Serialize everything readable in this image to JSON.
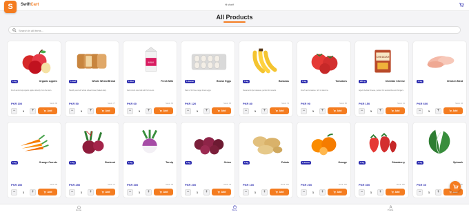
{
  "header": {
    "logo_letter": "S",
    "brand_main": "Swift",
    "brand_accent": "Cart",
    "greeting": "Hi sharif"
  },
  "page_title": "All Products",
  "search": {
    "placeholder": "Search in all items..."
  },
  "products": [
    {
      "name": "Organic Apples",
      "unit": "1 kg",
      "desc": "Fresh and crisp organic apples directly from the farm.",
      "price": "PKR 100",
      "stock": "Stock: 96",
      "qty": "1"
    },
    {
      "name": "Whole Wheat Bread",
      "unit": "1 loaf",
      "desc": "Healthy and soft whole wheat bread, baked daily.",
      "price": "PKR 50",
      "stock": "Stock: 77",
      "qty": "1"
    },
    {
      "name": "Fresh Milk",
      "unit": "1 liter",
      "desc": "Farm-fresh cow milk with full cream.",
      "price": "PKR 60",
      "stock": "Stock: 60",
      "qty": "1"
    },
    {
      "name": "Brown Eggs",
      "unit": "1 dozen",
      "desc": "Pack of 12 free-range brown eggs.",
      "price": "PKR 120",
      "stock": "Stock: 68",
      "qty": "1"
    },
    {
      "name": "Bananas",
      "unit": "1 kg",
      "desc": "Sweet and ripe bananas, perfect for snacks.",
      "price": "PKR 80",
      "stock": "Stock: 79",
      "qty": "1"
    },
    {
      "name": "Tomatoes",
      "unit": "1 kg",
      "desc": "Fresh red tomatoes, rich in vitamins.",
      "price": "PKR 90",
      "stock": "Stock: 86",
      "qty": "1"
    },
    {
      "name": "Cheddar Cheese",
      "unit": "200 g",
      "desc": "Aged cheddar cheese, perfect for sandwiches and burgers.",
      "price": "PKR 150",
      "stock": "Stock: 41",
      "qty": "1"
    },
    {
      "name": "Chicken Meat",
      "unit": "1 kg",
      "desc": "",
      "price": "PKR 600",
      "stock": "Stock: 34",
      "qty": "1"
    },
    {
      "name": "Orange Carrots",
      "unit": "1 kg",
      "desc": "",
      "price": "PKR 150",
      "stock": "Stock: 99",
      "qty": "1"
    },
    {
      "name": "Beetroot",
      "unit": "1 kg",
      "desc": "",
      "price": "PKR 250",
      "stock": "Stock: 37",
      "qty": "1"
    },
    {
      "name": "Turnip",
      "unit": "1 kg",
      "desc": "",
      "price": "PKR 300",
      "stock": "Stock: 99",
      "qty": "1"
    },
    {
      "name": "Onion",
      "unit": "1 kg",
      "desc": "",
      "price": "PKR 200",
      "stock": "Stock: 49",
      "qty": "1"
    },
    {
      "name": "Potato",
      "unit": "1 kg",
      "desc": "",
      "price": "PKR 100",
      "stock": "Stock: 100",
      "qty": "1"
    },
    {
      "name": "Orange",
      "unit": "1 dozen",
      "desc": "",
      "price": "PKR 200",
      "stock": "Stock: 100",
      "qty": "1"
    },
    {
      "name": "Strawberry",
      "unit": "1 kg",
      "desc": "",
      "price": "PKR 300",
      "stock": "Stock: 100",
      "qty": "1"
    },
    {
      "name": "Spinach",
      "unit": "1 kg",
      "desc": "",
      "price": "PKR 30",
      "stock": "Stock: 100",
      "qty": "1"
    }
  ],
  "add_label": "Add",
  "bottom_nav": [
    {
      "label": "Home",
      "icon": "home-icon"
    },
    {
      "label": "Store",
      "icon": "store-icon"
    },
    {
      "label": "Profile",
      "icon": "user-icon"
    }
  ],
  "colors": {
    "accent": "#f47c20",
    "primary": "#2f2fb0"
  }
}
